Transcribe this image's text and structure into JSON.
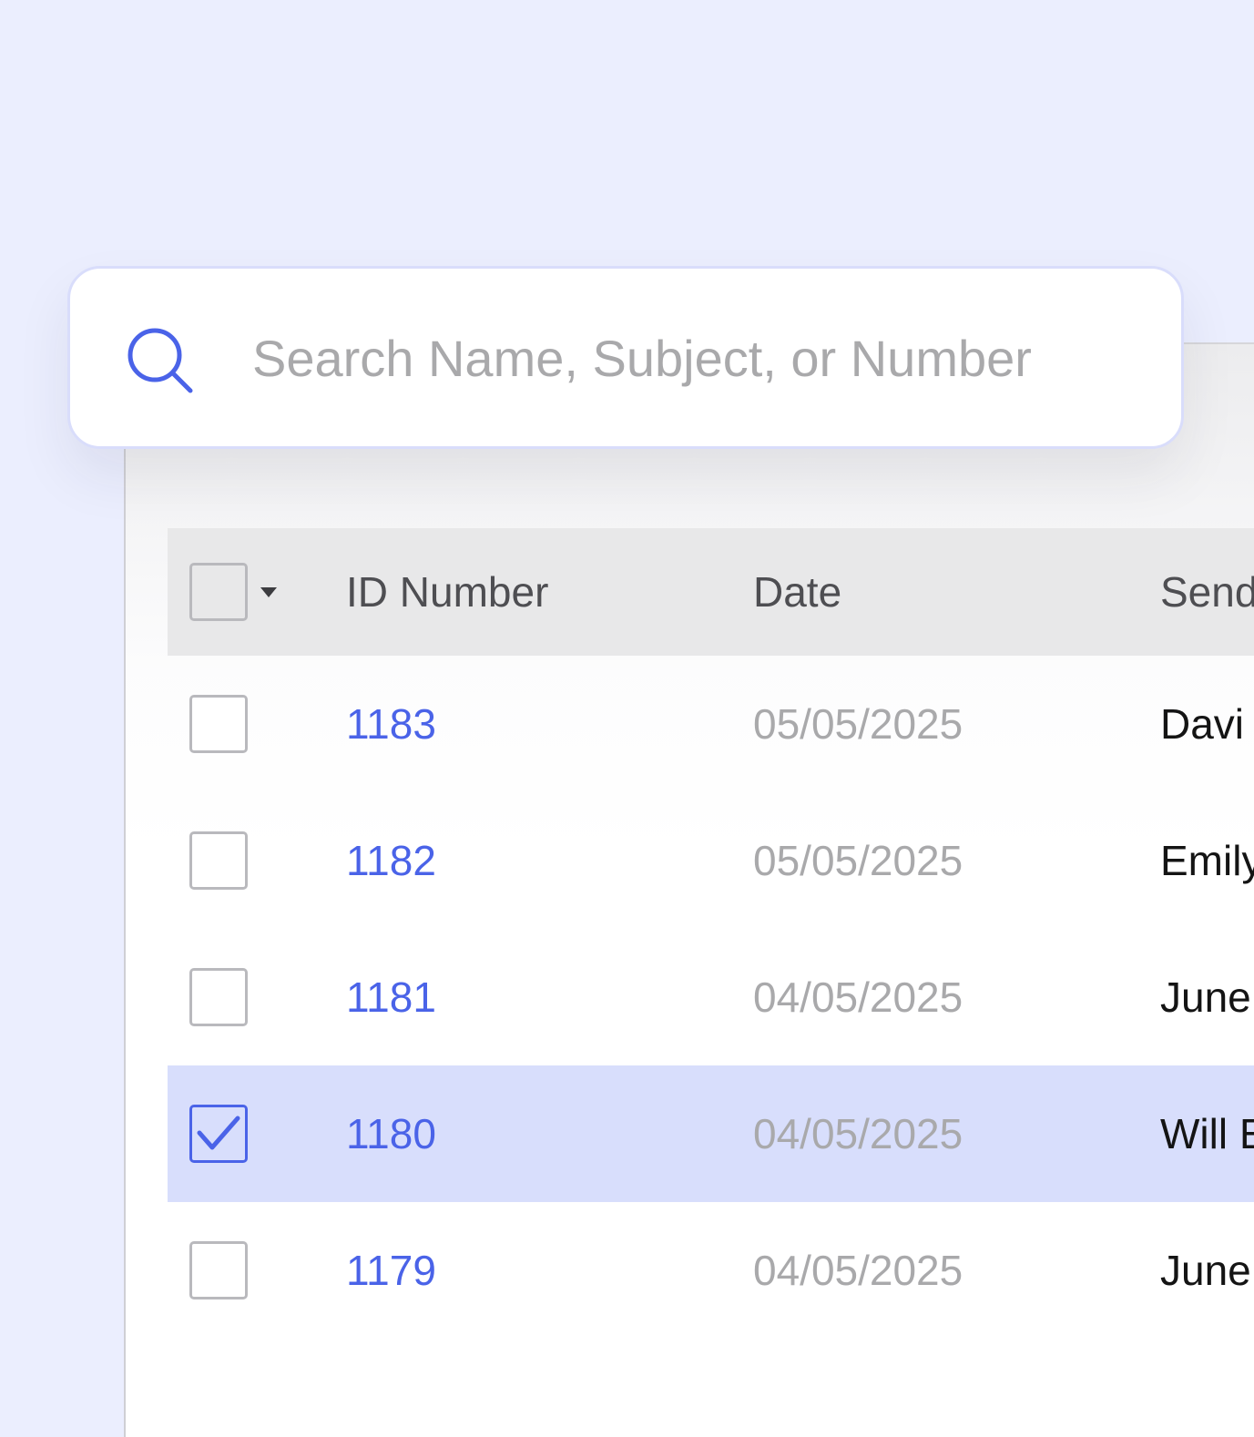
{
  "search": {
    "placeholder": "Search Name, Subject, or Number",
    "icon": "search-icon"
  },
  "table": {
    "columns": [
      "ID Number",
      "Date",
      "Send"
    ],
    "rows": [
      {
        "id": "1183",
        "date": "05/05/2025",
        "sender": "Davi",
        "checked": false
      },
      {
        "id": "1182",
        "date": "05/05/2025",
        "sender": "Emily",
        "checked": false
      },
      {
        "id": "1181",
        "date": "04/05/2025",
        "sender": "June",
        "checked": false
      },
      {
        "id": "1180",
        "date": "04/05/2025",
        "sender": "Will E",
        "checked": true
      },
      {
        "id": "1179",
        "date": "04/05/2025",
        "sender": "June",
        "checked": false
      }
    ]
  },
  "colors": {
    "background": "#ebeefe",
    "accent": "#4a63e8",
    "selected_row": "#d8defc",
    "header_row": "#e8e8e9",
    "muted_text": "#a9a9ab"
  }
}
